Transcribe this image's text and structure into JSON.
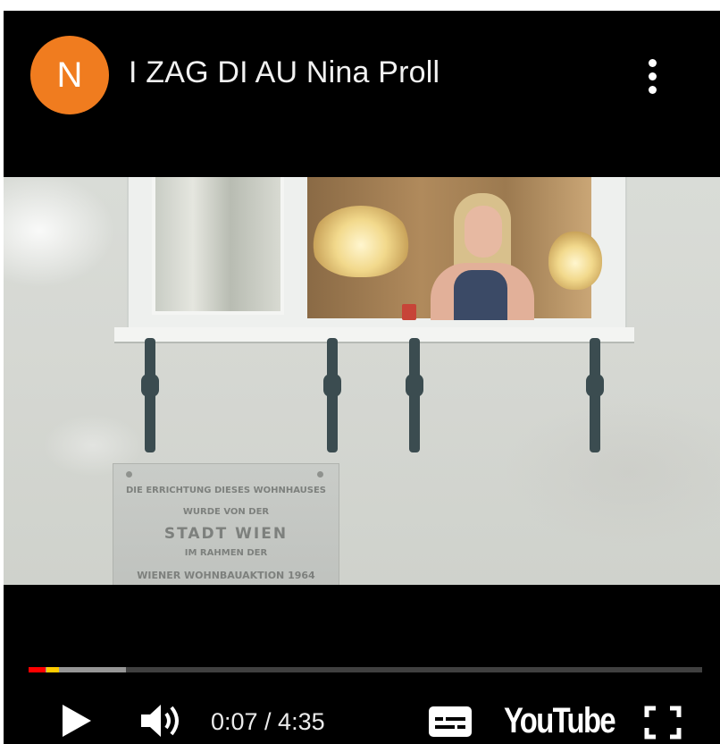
{
  "header": {
    "avatar_letter": "N",
    "title": "I ZAG DI AU Nina Proll"
  },
  "video": {
    "plaque": {
      "line1": "DIE ERRICHTUNG DIESES WOHNHAUSES",
      "line2": "WURDE VON DER",
      "line3": "STADT WIEN",
      "line4": "IM RAHMEN DER",
      "line5": "WIENER WOHNBAUAKTION 1964"
    }
  },
  "controls": {
    "current_time": "0:07",
    "duration": "4:35",
    "time_display": "0:07 / 4:35",
    "played_fraction": 0.025,
    "buffered_fraction": 0.145,
    "logo_text": "YouTube"
  },
  "colors": {
    "avatar_bg": "#f07c1f",
    "progress_played": "#ff0000",
    "ad_marker": "#ffcc00"
  },
  "icons": [
    "more-vert-icon",
    "play-icon",
    "volume-icon",
    "subtitles-icon",
    "fullscreen-icon"
  ]
}
